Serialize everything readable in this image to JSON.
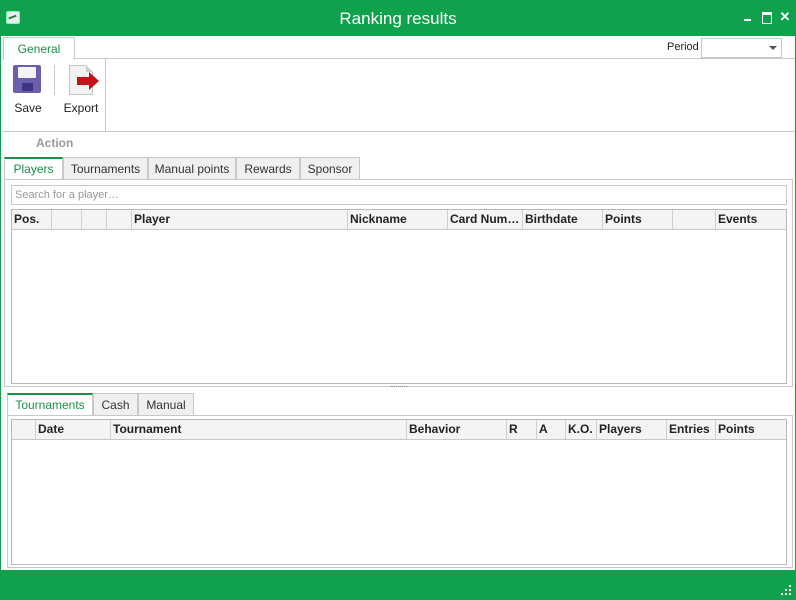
{
  "window": {
    "title": "Ranking results",
    "app_icon": "ranking-app-icon",
    "controls": {
      "minimize": "minimize-icon",
      "maximize": "maximize-icon",
      "close": "✕"
    }
  },
  "ribbon": {
    "tab_label": "General",
    "period_label": "Period",
    "period_value": "",
    "group_label": "Action",
    "buttons": [
      {
        "label": "Save",
        "icon": "floppy-disk-icon"
      },
      {
        "label": "Export",
        "icon": "export-document-icon"
      }
    ]
  },
  "top_tabs": [
    "Players",
    "Tournaments",
    "Manual points",
    "Rewards",
    "Sponsor"
  ],
  "players": {
    "search_placeholder": "Search for a player…",
    "columns": [
      "Pos.",
      "",
      "",
      "",
      "Player",
      "Nickname",
      "Card Num…",
      "Birthdate",
      "Points",
      "",
      "Events"
    ]
  },
  "bottom_tabs": [
    "Tournaments",
    "Cash",
    "Manual"
  ],
  "tournaments": {
    "columns": [
      "",
      "Date",
      "Tournament",
      "Behavior",
      "R",
      "A",
      "K.O.",
      "Players",
      "Entries",
      "Points"
    ]
  },
  "colors": {
    "accent": "#10a14d",
    "tab_text": "#1a8f47"
  }
}
